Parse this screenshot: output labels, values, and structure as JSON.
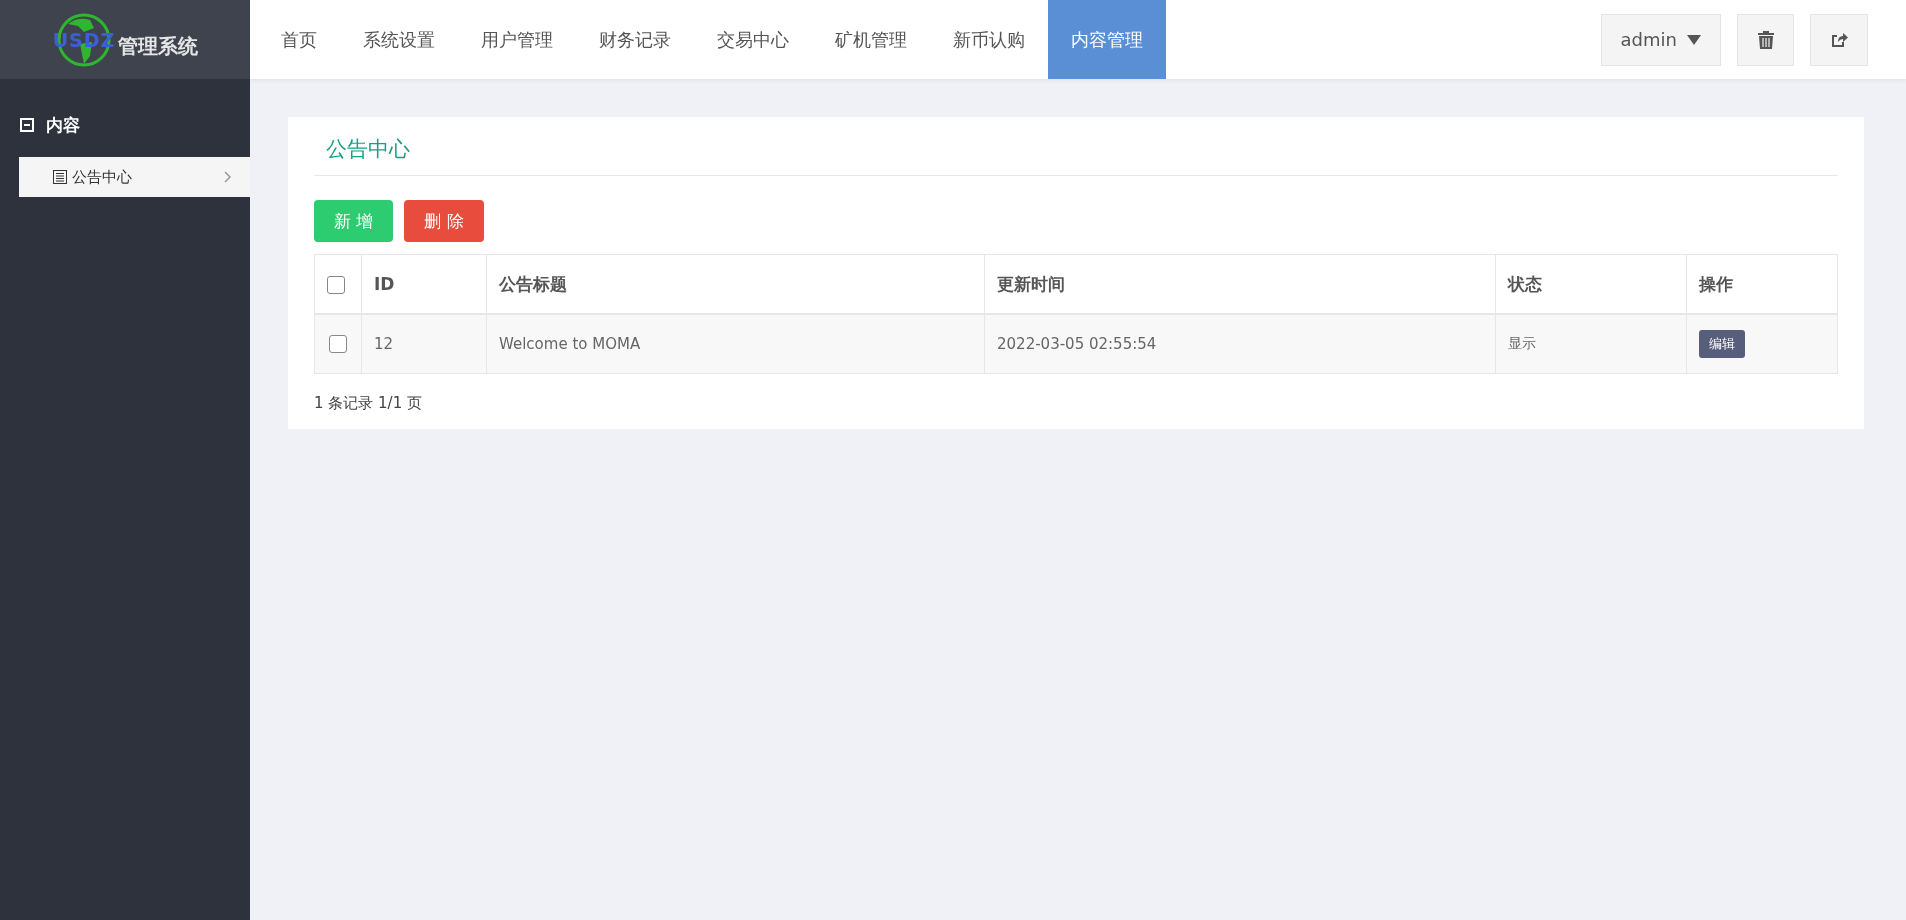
{
  "logo": {
    "mark": "USDZ",
    "title": "管理系统"
  },
  "nav": [
    {
      "label": "首页",
      "selected": false
    },
    {
      "label": "系统设置",
      "selected": false
    },
    {
      "label": "用户管理",
      "selected": false
    },
    {
      "label": "财务记录",
      "selected": false
    },
    {
      "label": "交易中心",
      "selected": false
    },
    {
      "label": "矿机管理",
      "selected": false
    },
    {
      "label": "新币认购",
      "selected": false
    },
    {
      "label": "内容管理",
      "selected": true
    }
  ],
  "user_menu": {
    "label": "admin"
  },
  "sidebar": {
    "group": {
      "label": "内容",
      "expanded": true,
      "children": [
        {
          "label": "公告中心",
          "selected": true
        }
      ]
    }
  },
  "panel": {
    "title": "公告中心",
    "buttons": [
      {
        "label": "新 增",
        "kind": "add"
      },
      {
        "label": "删 除",
        "kind": "delete"
      }
    ],
    "table": {
      "columns": [
        "ID",
        "公告标题",
        "更新时间",
        "状态",
        "操作"
      ],
      "header_checked": false,
      "rows": [
        {
          "checked": false,
          "id": "12",
          "title": "Welcome to MOMA",
          "updated": "2022-03-05 02:55:54",
          "status": "显示",
          "action": "编辑"
        }
      ]
    },
    "pagination": "1 条记录 1/1 页"
  }
}
